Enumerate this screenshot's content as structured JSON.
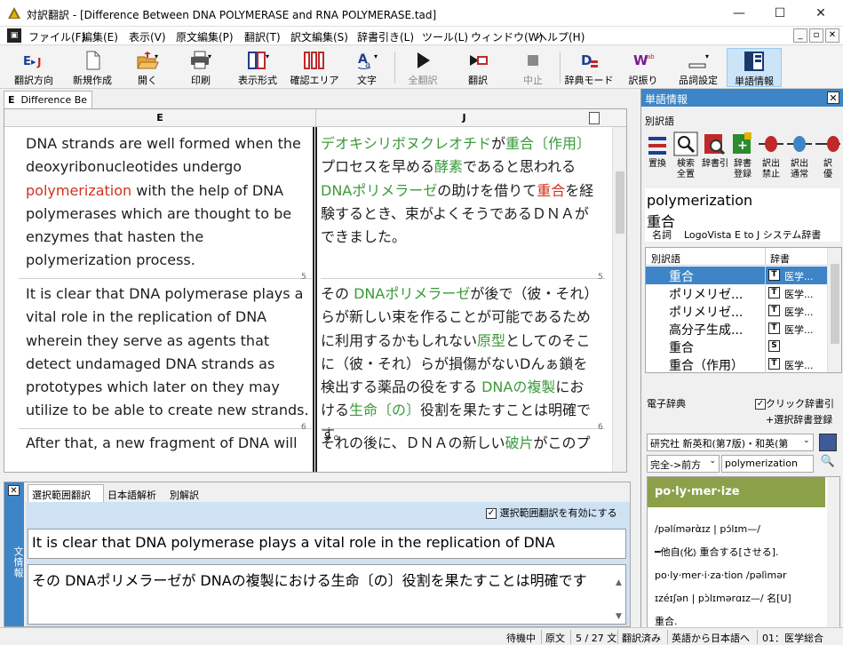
{
  "window": {
    "title": "対訳翻訳 - [Difference Between DNA POLYMERASE and RNA POLYMERASE.tad]",
    "minimize": "—",
    "maximize": "☐",
    "close": "✕"
  },
  "menu": [
    "ファイル(F)",
    "編集(E)",
    "表示(V)",
    "原文編集(P)",
    "翻訳(T)",
    "訳文編集(S)",
    "辞書引き(L)",
    "ツール(L)",
    "ウィンドウ(W)",
    "ヘルプ(H)"
  ],
  "menu_controls": [
    "_",
    "▫",
    "✕"
  ],
  "toolbar": [
    {
      "label": "翻訳方向",
      "icon": "direction-icon"
    },
    {
      "label": "新規作成",
      "icon": "new-document-icon"
    },
    {
      "label": "開く",
      "icon": "open-folder-icon"
    },
    {
      "label": "印刷",
      "icon": "printer-icon"
    },
    {
      "label": "表示形式",
      "icon": "layout-icon"
    },
    {
      "label": "確認エリア",
      "icon": "columns-icon"
    },
    {
      "label": "文字",
      "icon": "font-icon"
    },
    {
      "label": "全翻訳",
      "icon": "play-icon"
    },
    {
      "label": "翻訳",
      "icon": "translate-icon"
    },
    {
      "label": "中止",
      "icon": "stop-icon"
    },
    {
      "label": "辞典モード",
      "icon": "dictionary-mode-icon"
    },
    {
      "label": "訳振り",
      "icon": "word-assign-icon"
    },
    {
      "label": "品詞設定",
      "icon": "part-of-speech-icon"
    },
    {
      "label": "単語情報",
      "icon": "word-info-icon"
    }
  ],
  "doc_tab": {
    "icon": "E",
    "label": "Difference Be"
  },
  "columns": {
    "left": "E",
    "right": "J"
  },
  "rows": [
    {
      "num": "5",
      "en": [
        [
          "DNA strands are well formed when the deoxyribonucleotides undergo ",
          ""
        ],
        [
          "polymerization",
          "red"
        ],
        [
          " with the help of DNA polymerases which are thought to be enzymes that hasten the polymerization process.",
          ""
        ]
      ],
      "ja": [
        [
          "デオキシリボヌクレオチド",
          "green"
        ],
        [
          "が",
          ""
        ],
        [
          "重合〔作用〕",
          "green"
        ],
        [
          "プロセスを早める",
          ""
        ],
        [
          "酵素",
          "green"
        ],
        [
          "であると思われる",
          ""
        ],
        [
          "DNAポリメラーゼ",
          "green"
        ],
        [
          "の助けを借りて",
          ""
        ],
        [
          "重合",
          "red"
        ],
        [
          "を経験するとき、束がよくそうであるＤＮＡができました。",
          ""
        ]
      ]
    },
    {
      "num": "6",
      "en": [
        [
          "It is clear that DNA polymerase plays a vital role in the replication of DNA wherein they serve as agents that detect undamaged DNA strands as prototypes which later on they may utilize to be able to create new strands.",
          ""
        ]
      ],
      "ja": [
        [
          "その ",
          ""
        ],
        [
          "DNAポリメラーゼ",
          "green"
        ],
        [
          "が後で（彼・それ）らが新しい束を作ることが可能であるために利用するかもしれない",
          ""
        ],
        [
          "原型",
          "green"
        ],
        [
          "としてのそこに（彼・それ）らが損傷がないDんぁ鎖を検出する薬品の役をする ",
          ""
        ],
        [
          "DNAの複製",
          "green"
        ],
        [
          "における",
          ""
        ],
        [
          "生命〔の〕",
          "green"
        ],
        [
          "役割を果たすことは明確です。",
          ""
        ]
      ]
    },
    {
      "num": "",
      "en": [
        [
          "After that, a new fragment of DNA will",
          ""
        ]
      ],
      "ja": [
        [
          "それの後に、ＤＮＡの新しい",
          ""
        ],
        [
          "破片",
          "green"
        ],
        [
          "がこのプ",
          ""
        ]
      ]
    }
  ],
  "bottom": {
    "side_label": "文情報",
    "tabs": [
      "選択範囲翻訳",
      "日本語解析",
      "別解訳"
    ],
    "checkbox_label": "選択範囲翻訳を有効にする",
    "source": "It is clear that DNA polymerase plays a vital role in the replication of DNA",
    "target": "その DNAポリメラーゼが DNAの複製における生命〔の〕役割を果たすことは明確です"
  },
  "word_info": {
    "header": "単語情報",
    "section": "別訳語",
    "buttons": [
      {
        "label": "置換",
        "icon": "replace-icon"
      },
      {
        "label": "検索\n全置",
        "icon": "search-icon"
      },
      {
        "label": "辞書引",
        "icon": "dictionary-lookup-icon"
      },
      {
        "label": "辞書\n登録",
        "icon": "dictionary-register-icon"
      },
      {
        "label": "訳出\n禁止",
        "icon": "forbid-icon"
      },
      {
        "label": "訳出\n通常",
        "icon": "normal-icon"
      },
      {
        "label": "訳\n優",
        "icon": "priority-icon"
      }
    ],
    "word": "polymerization",
    "translation": "重合",
    "pos": "名詞",
    "dictionary": "LogoVista E to J システム辞書",
    "list_headers": [
      "別訳語",
      "辞書"
    ],
    "list": [
      {
        "term": "重合",
        "dict": "医学...",
        "selected": true,
        "badge": "T"
      },
      {
        "term": "ポリメリゼ...",
        "dict": "医学...",
        "badge": "T"
      },
      {
        "term": "ポリメリゼ...",
        "dict": "医学...",
        "badge": "T"
      },
      {
        "term": "高分子生成...",
        "dict": "医学...",
        "badge": "T"
      },
      {
        "term": "重合",
        "dict": "",
        "badge": "S"
      },
      {
        "term": "重合（作用）",
        "dict": "医学...",
        "badge": "T"
      }
    ]
  },
  "edict": {
    "header": "電子辞典",
    "click_lookup": "クリック辞書引",
    "select_register": "+選択辞書登録",
    "dict_select": "研究社 新英和(第7版)・和英(第",
    "mode": "完全->前方",
    "query": "polymerization",
    "entry_head": "po·ly·mer·ize",
    "lines": [
      "/pəlímərὰɪz | pɔ́lɪm—/",
      "━他自⦅化⦆ 重合する[させる].",
      "po·ly·mer·i·za·tion /pəlìmər",
      "ɪzéɪʃən | pɔ̀lɪmərɑɪz—/ 名[U]",
      "重合."
    ]
  },
  "status": [
    "待機中",
    "原文",
    "5 / 27 文",
    "翻訳済み",
    "英語から日本語へ",
    "01：医学総合"
  ]
}
